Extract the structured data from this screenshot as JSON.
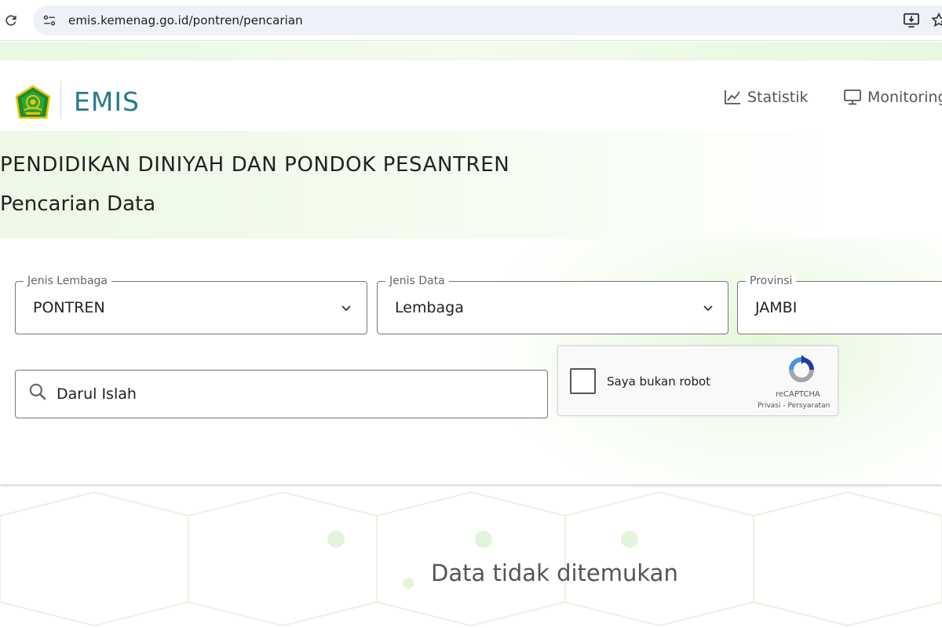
{
  "browser": {
    "url": "emis.kemenag.go.id/pontren/pencarian",
    "icons": [
      "reload-icon",
      "site-info-icon",
      "install-app-icon",
      "bookmark-icon"
    ]
  },
  "header": {
    "logo_text": "EMIS",
    "nav": [
      {
        "label": "Statistik",
        "icon": "chart-line-icon"
      },
      {
        "label": "Monitoring",
        "icon": "monitor-icon"
      }
    ]
  },
  "titles": {
    "main": "PENDIDIKAN DINIYAH DAN PONDOK PESANTREN",
    "sub": "Pencarian Data"
  },
  "filters": {
    "jenis_lembaga": {
      "label": "Jenis Lembaga",
      "value": "PONTREN"
    },
    "jenis_data": {
      "label": "Jenis Data",
      "value": "Lembaga"
    },
    "provinsi": {
      "label": "Provinsi",
      "value": "JAMBI"
    }
  },
  "search": {
    "value": "Darul Islah"
  },
  "recaptcha": {
    "label": "Saya bukan robot",
    "brand": "reCAPTCHA",
    "privacy": "Privasi",
    "separator": " - ",
    "terms": "Persyaratan"
  },
  "result": {
    "message": "Data tidak ditemukan"
  },
  "colors": {
    "accent_green": "#3aa335",
    "logo_teal": "#2a7a8a",
    "band_green": "#edf9e6",
    "recaptcha_blue": "#4a90e2"
  }
}
